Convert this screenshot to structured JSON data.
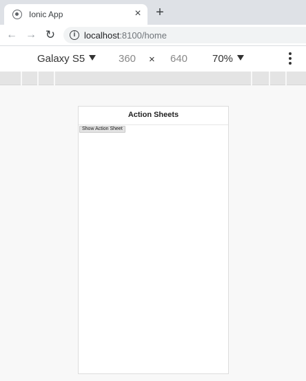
{
  "browser": {
    "tab": {
      "title": "Ionic App",
      "close_glyph": "×",
      "favicon": "ionic-favicon-icon"
    },
    "new_tab_glyph": "+",
    "nav": {
      "back_glyph": "←",
      "forward_glyph": "→",
      "reload_glyph": "↻"
    },
    "address": {
      "host": "localhost",
      "path": ":8100/home",
      "info_glyph": "i"
    }
  },
  "devtools": {
    "device": "Galaxy S5",
    "width": "360",
    "times": "×",
    "height": "640",
    "zoom": "70%"
  },
  "app": {
    "title": "Action Sheets",
    "show_button_label": "Show Action Sheet"
  }
}
